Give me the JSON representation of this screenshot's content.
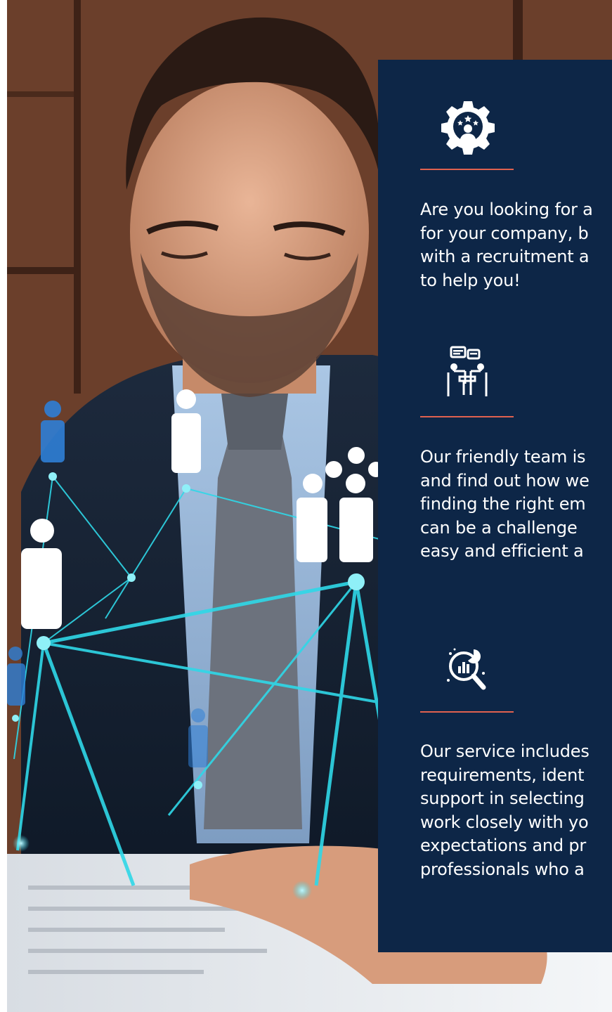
{
  "features": [
    {
      "icon": "gear-person-stars-icon",
      "lines": [
        "Are you looking for a",
        "for your company, b",
        "with a recruitment a",
        "to help you!"
      ]
    },
    {
      "icon": "meeting-chat-icon",
      "lines": [
        "Our friendly team is",
        "and find out how we",
        "finding the right em",
        "can be a challenge",
        "easy and efficient a"
      ]
    },
    {
      "icon": "analytics-search-icon",
      "lines": [
        "Our service includes",
        "requirements, ident",
        "support in selecting",
        "work closely with yo",
        "expectations and pr",
        "professionals who a"
      ]
    }
  ],
  "colors": {
    "panel": "#0d2647",
    "accent": "#e0614f",
    "text": "#ffffff",
    "network": "#2fd8e8"
  }
}
